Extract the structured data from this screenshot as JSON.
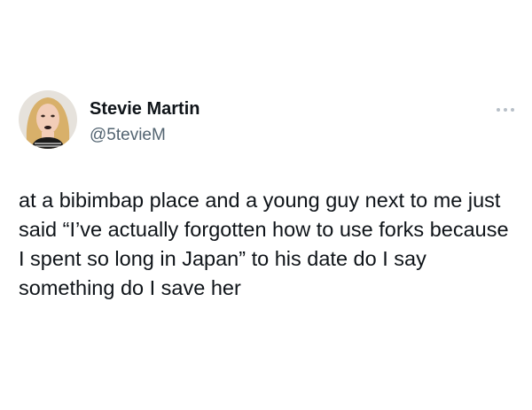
{
  "author": {
    "display_name": "Stevie Martin",
    "handle": "@5tevieM",
    "avatar_icon": "profile-photo"
  },
  "menu": {
    "icon": "more-options-icon"
  },
  "tweet": {
    "text": "at a bibimbap place and a young guy next to me just said “I’ve actually forgotten how to use forks because I spent so long in Japan” to his date do I say something do I save her"
  },
  "colors": {
    "text_primary": "#0f1419",
    "text_secondary": "#536471",
    "background": "#ffffff",
    "more_icon": "#b8c0c8"
  }
}
